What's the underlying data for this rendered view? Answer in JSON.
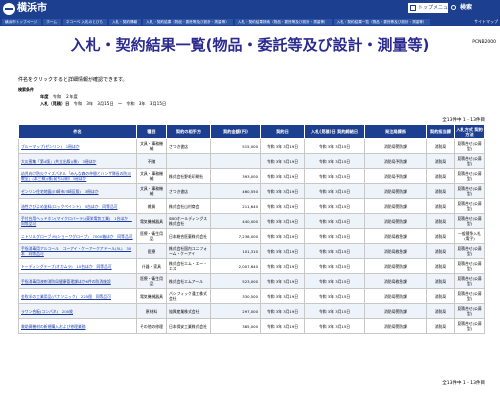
{
  "header": {
    "logo_text": "横浜市",
    "top_menu": "トップメニュー",
    "search_label": "検索",
    "breadcrumbs": [
      "横浜市トップページ",
      "ホーム",
      "ネコーベ 入札のとびら",
      "入札・契約情報",
      "入札・契約結果（物品・委託等及び設計・測量等）",
      "入札・契約結果検索（物品・委託等及び設計・測量等）",
      "入札・契約結果一覧（物品・委託等及び設計・測量等）"
    ],
    "sitemap": "サイトマップ"
  },
  "page": {
    "title": "入札・契約結果一覧(物品・委託等及び設計・測量等)",
    "code": "PCNB2000",
    "intro": "件名をクリックすると詳細情報が確認できます。",
    "cond_head": "検索条件",
    "cond_year_label": "年度",
    "cond_year_value": "令和　２年度",
    "cond_date_label": "入札（見積）日",
    "cond_date_value": "令和　3年　3月15日　～　令和　3年　3月15日",
    "count_text": "全13件中 1 - 13件目"
  },
  "table": {
    "headers": [
      "件名",
      "種目",
      "契約の相手方",
      "契約金額(円)",
      "契約日",
      "入札(見積)日\n契約締結日",
      "発注局課係",
      "契約担当課",
      "入札方式\n契約方法"
    ],
    "rows": [
      [
        "ブルーマップ(ゼンリン)　1冊ほか",
        "文具・事務機械",
        "さつき書店",
        "515,000",
        "令和 3年 3月19日",
        "令和 3年 3月15日",
        "消防局警防課",
        "消防局",
        "見積合せ(公募型)"
      ],
      [
        "大災害集「第4版」(共立出版)(株)　3冊ほか",
        "不随",
        "",
        "",
        "令和 3年 3月19日",
        "令和 3年 3月15日",
        "消防局予防課",
        "消防局",
        "見積合せ(公募型)"
      ],
      [
        "幼児向け防災クイズパネル「みんな森の仲間とハンザ隊長の防災教室」(本三郷)(株)発ち印刷）3冊ほか",
        "文具・事務機械",
        "株式会社野毛印刷社",
        "393,000",
        "令和 3年 3月19日",
        "令和 3年 3月15日",
        "消防局予防課",
        "消防局",
        "見積合せ(公募型)"
      ],
      [
        "ゼンリン住宅地図(川崎市川崎区版)　3冊ほか",
        "文具・事務機械",
        "さつき書店",
        "460,550",
        "令和 3年 3月19日",
        "令和 3年 3月15日",
        "消防局警防課",
        "消防局",
        "見積合せ(公募型)"
      ],
      [
        "油性さびよめ塗料(ロックペイント)　5缶ほか　同等品可",
        "雑貨",
        "株式会社山村商会",
        "211,640",
        "令和 3年 3月19日",
        "令和 3年 3月15日",
        "消防局警防課",
        "消防局",
        "見積合せ(公募型)"
      ],
      [
        "手付台用ヘッドホン(マイクロバーテ)(東栄電気工業)　1台ほか　同等品可",
        "電気機械器具",
        "SBOホールディングス株式会社",
        "440,000",
        "令和 3年 3月19日",
        "令和 3年 3月15日",
        "消防局警防課",
        "消防局",
        "見積合せ(公募型)"
      ],
      [
        "ニトリルグローブ M(ショーワグローブ)　7000箱ほか　同等品可",
        "医療・衛生用品",
        "日本総合医薬株式会社",
        "7,238,000",
        "令和 3年 3月19日",
        "令和 3年 3月15日",
        "消防局救急課",
        "消防局",
        "一般競争入札(電子)"
      ],
      [
        "手指消毒用アルコール　ユーアイ・ケーアークアドール(5L)　30本　同等品可",
        "医療",
        "株式会社国内ユニフォーム・ケーアイ",
        "101,310",
        "令和 3年 3月19日",
        "令和 3年 3月15日",
        "消防局救急課",
        "消防局",
        "見積合せ(公募型)"
      ],
      [
        "トーディングテープ(オカムラ)　10台ほか　同等品可",
        "什器・家具",
        "株式会社エム・エー・エス",
        "2,007,640",
        "令和 3年 3月19日",
        "令和 3年 3月15日",
        "消防局警防課",
        "消防局",
        "見積合せ(公募型)"
      ],
      [
        "手指消毒用液剤消防局健康管理課ほか6件の防消施設",
        "医療・衛生用品",
        "株式会社エムアール",
        "523,000",
        "令和 3年 3月19日",
        "令和 3年 3月15日",
        "消防局救急課",
        "消防局",
        "見積合せ(公募型)"
      ],
      [
        "金吹半の工業用品(パナソニック)　225個　同等品可",
        "電気機械器具",
        "パシフィック通工株式会社",
        "330,500",
        "令和 3年 3月19日",
        "令和 3年 3月15日",
        "消防局警防課",
        "消防局",
        "見積合せ(公募型)"
      ],
      [
        "ラワン合板(コンパネ)　200枚",
        "原材料",
        "協興産業株式会社",
        "297,000",
        "令和 3年 3月19日",
        "令和 3年 3月15日",
        "消防局警防課",
        "消防局",
        "見積合せ(公募型)"
      ],
      [
        "救助資機材の新規購入および修理業務",
        "その他の修理",
        "日本保安工業株式会社",
        "385,000",
        "令和 3年 3月19日",
        "令和 3年 3月15日",
        "消防局警防課",
        "消防局",
        "見積合せ(公募型)"
      ]
    ]
  }
}
